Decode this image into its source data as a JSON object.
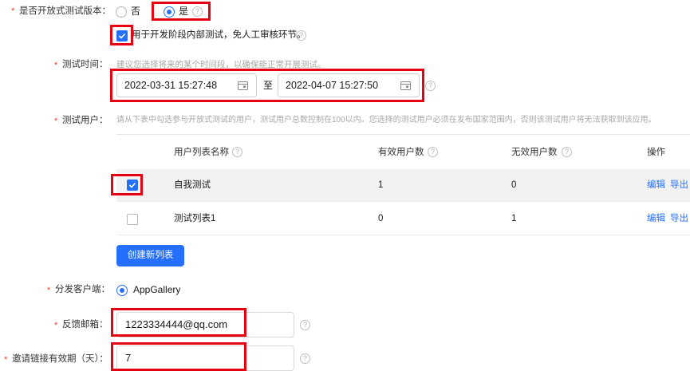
{
  "open_test": {
    "label": "是否开放式测试版本：",
    "options": [
      {
        "label": "否",
        "selected": false
      },
      {
        "label": "是",
        "selected": true
      }
    ],
    "internal_checkbox_checked": true,
    "internal_note": "用于开发阶段内部测试，免人工审核环节。"
  },
  "test_time": {
    "label": "测试时间：",
    "hint": "建议您选择将来的某个时间段，以确保能正常开展测试。",
    "start": "2022-03-31 15:27:48",
    "to_label": "至",
    "end": "2022-04-07 15:27:50"
  },
  "test_users": {
    "label": "测试用户：",
    "hint": "请从下表中勾选参与开放式测试的用户，测试用户总数控制在100以内。您选择的测试用户必须在发布国家范围内，否则该测试用户将无法获取到该应用。",
    "columns": {
      "name": "用户列表名称",
      "valid": "有效用户数",
      "invalid": "无效用户数",
      "action": "操作"
    },
    "rows": [
      {
        "checked": true,
        "name": "自我测试",
        "valid": "1",
        "invalid": "0",
        "edit": "编辑",
        "export": "导出"
      },
      {
        "checked": false,
        "name": "测试列表1",
        "valid": "0",
        "invalid": "1",
        "edit": "编辑",
        "export": "导出"
      }
    ],
    "create_button": "创建新列表"
  },
  "client": {
    "label": "分发客户端：",
    "option": "AppGallery"
  },
  "email": {
    "label": "反馈邮箱：",
    "value": "1223334444@qq.com"
  },
  "invite": {
    "label": "邀请链接有效期（天）：",
    "value": "7"
  },
  "required_mark": "*",
  "colors": {
    "accent": "#256fff",
    "highlight": "#e50012",
    "required": "#e84026"
  }
}
